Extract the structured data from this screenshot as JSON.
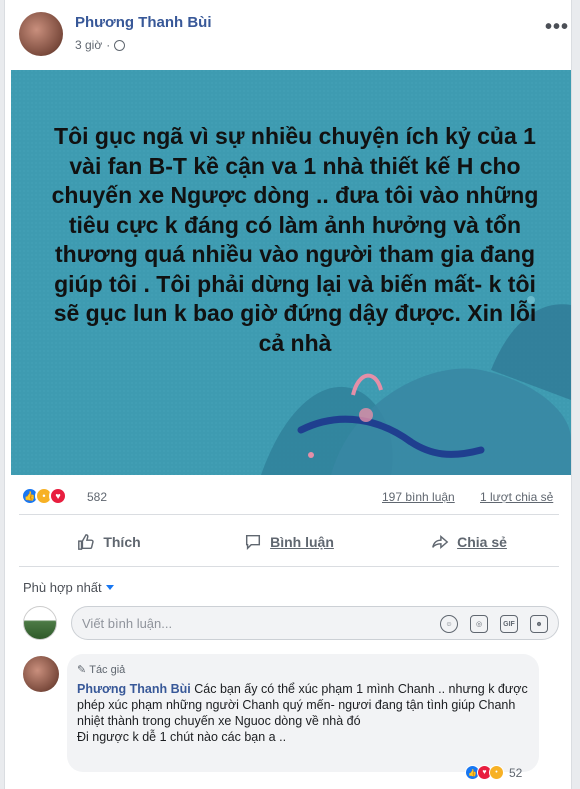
{
  "post": {
    "author": "Phương Thanh Bùi",
    "time": "3 giờ",
    "more_label": "•••",
    "image_text": "Tôi gục ngã vì sự nhiều chuyện ích kỷ của 1 vài fan B-T kề cận va 1 nhà thiết kế H cho chuyến xe Ngược dòng .. đưa tôi vào những tiêu cực k đáng có làm ảnh hưởng và tổn thương quá nhiều vào người tham gia đang giúp tôi . Tôi phải dừng lại và biến mất- k tôi sẽ gục lun k bao giờ đứng dậy được. Xin lỗi cả nhà",
    "image_bg_color": "#3e9bb1"
  },
  "reactions": {
    "count": "582",
    "comments": "197 bình luận",
    "shares": "1 lượt chia sẻ"
  },
  "actions": {
    "like": "Thích",
    "comment": "Bình luận",
    "share": "Chia sẻ"
  },
  "comments_section": {
    "sort_label": "Phù hợp nhất",
    "input_placeholder": "Viết bình luận...",
    "gif_label": "GIF"
  },
  "comment": {
    "badge": "Tác giả",
    "author": "Phương Thanh Bùi",
    "text": "Các bạn ấy có thể xúc phạm 1 mình Chanh .. nhưng k được phép xúc phạm những người Chanh quý mến- ngươi đang tận tình giúp Chanh nhiệt thành trong chuyến xe Nguoc dòng về nhà đó",
    "text2": "Đi ngược k dễ 1 chút nào các bạn a ..",
    "reaction_count": "52"
  },
  "colors": {
    "link_blue": "#385898",
    "like_blue": "#1877f2",
    "love_red": "#e81e3f",
    "sad_yellow": "#f7b125"
  }
}
